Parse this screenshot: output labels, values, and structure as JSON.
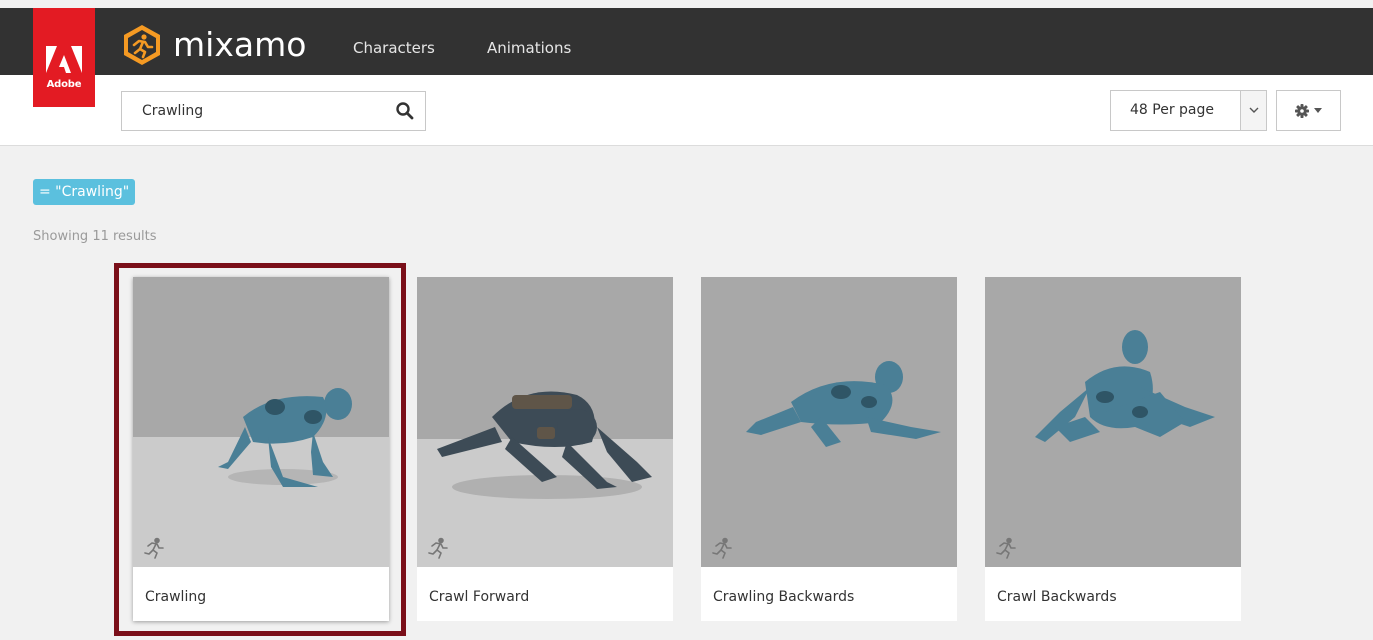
{
  "header": {
    "adobe_label": "Adobe",
    "brand_name": "mixamo",
    "nav": [
      {
        "label": "Characters"
      },
      {
        "label": "Animations"
      }
    ]
  },
  "toolbar": {
    "search": {
      "value": "Crawling",
      "placeholder": "",
      "icon": "search-icon"
    },
    "per_page": {
      "selected": "48 Per page"
    },
    "settings_icon": "gear-icon"
  },
  "filter": {
    "tag": "= \"Crawling\""
  },
  "results": {
    "summary": "Showing 11 results",
    "cards": [
      {
        "title": "Crawling",
        "selected": true,
        "icon": "running-figure-icon"
      },
      {
        "title": "Crawl Forward",
        "selected": false,
        "icon": "running-figure-icon"
      },
      {
        "title": "Crawling Backwards",
        "selected": false,
        "icon": "running-figure-icon"
      },
      {
        "title": "Crawl Backwards",
        "selected": false,
        "icon": "running-figure-icon"
      }
    ]
  },
  "colors": {
    "topbar": "#323232",
    "adobe_red": "#e31b23",
    "brand_orange": "#f59a23",
    "tag_blue": "#5bc0de",
    "selected_outline": "#7a0f19",
    "thumb_wall": "#a6a6a6",
    "thumb_floor": "#c9c9c9",
    "figure_blue": "#4a7f96"
  }
}
